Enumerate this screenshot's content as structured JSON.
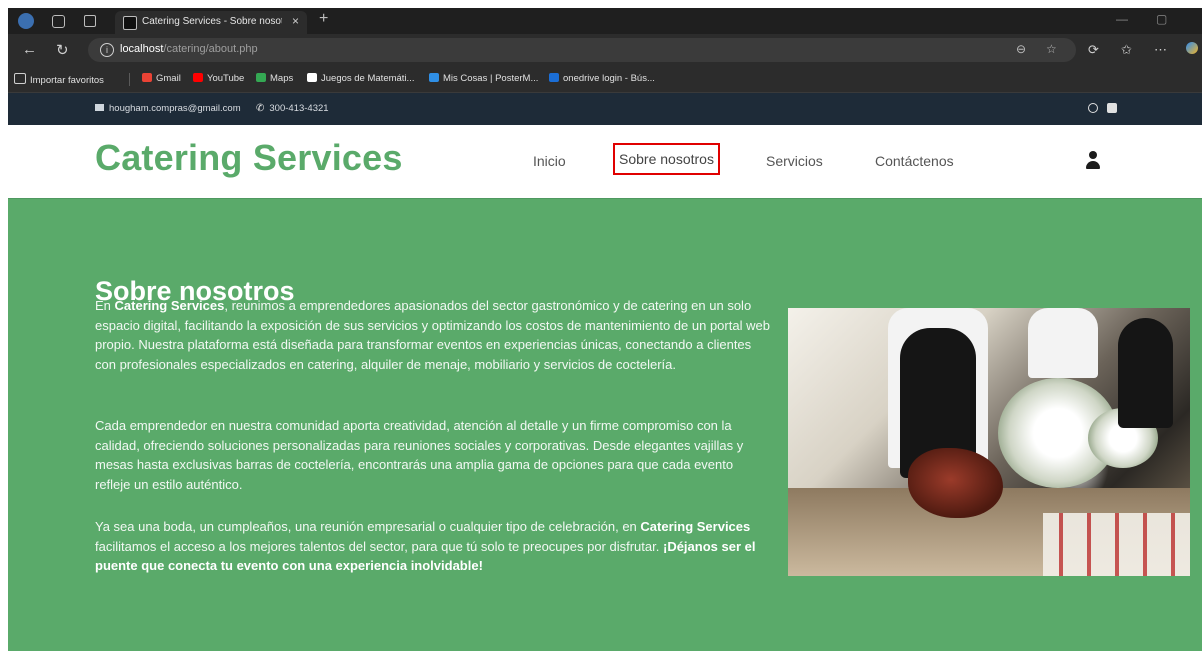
{
  "browser": {
    "tab_title": "Catering Services - Sobre nosotros",
    "tab_close": "×",
    "new_tab": "+",
    "url_host": "localhost",
    "url_path": "/catering/about.php",
    "bookmarks": [
      {
        "label": "Importar favoritos",
        "color": "#cfcfcf"
      },
      {
        "label": "Gmail",
        "color": "#ea4335"
      },
      {
        "label": "YouTube",
        "color": "#ff0000"
      },
      {
        "label": "Maps",
        "color": "#34a853"
      },
      {
        "label": "Juegos de Matemáti...",
        "color": "#ffffff"
      },
      {
        "label": "Mis Cosas | PosterM...",
        "color": "#2f8fe6"
      },
      {
        "label": "onedrive login - Bús...",
        "color": "#1b6ed6"
      }
    ]
  },
  "topbar": {
    "email": "hougham.compras@gmail.com",
    "phone": "300-413-4321"
  },
  "header": {
    "brand": "Catering Services",
    "nav": [
      {
        "label": "Inicio"
      },
      {
        "label": "Sobre nosotros",
        "active": true
      },
      {
        "label": "Servicios"
      },
      {
        "label": "Contáctenos"
      }
    ]
  },
  "about": {
    "title": "Sobre nosotros",
    "p1_pre": "En ",
    "p1_brand": "Catering Services",
    "p1_post": ", reunimos a emprendedores apasionados del sector gastronómico y de catering en un solo espacio digital, facilitando la exposición de sus servicios y optimizando los costos de mantenimiento de un portal web propio. Nuestra plataforma está diseñada para transformar eventos en experiencias únicas, conectando a clientes con profesionales especializados en catering, alquiler de menaje, mobiliario y servicios de coctelería.",
    "p2": "Cada emprendedor en nuestra comunidad aporta creatividad, atención al detalle y un firme compromiso con la calidad, ofreciendo soluciones personalizadas para reuniones sociales y corporativas. Desde elegantes vajillas y mesas hasta exclusivas barras de coctelería, encontrarás una amplia gama de opciones para que cada evento refleje un estilo auténtico.",
    "p3_pre": "Ya sea una boda, un cumpleaños, una reunión empresarial o cualquier tipo de celebración, en ",
    "p3_brand": "Catering Services",
    "p3_mid": " facilitamos el acceso a los mejores talentos del sector, para que tú solo te preocupes por disfrutar. ",
    "p3_strong": "¡Déjanos ser el puente que conecta tu evento con una experiencia inolvidable!"
  },
  "colors": {
    "brand_green": "#5aaa6a",
    "topbar_navy": "#1e2b38",
    "highlight_red": "#e00000"
  }
}
